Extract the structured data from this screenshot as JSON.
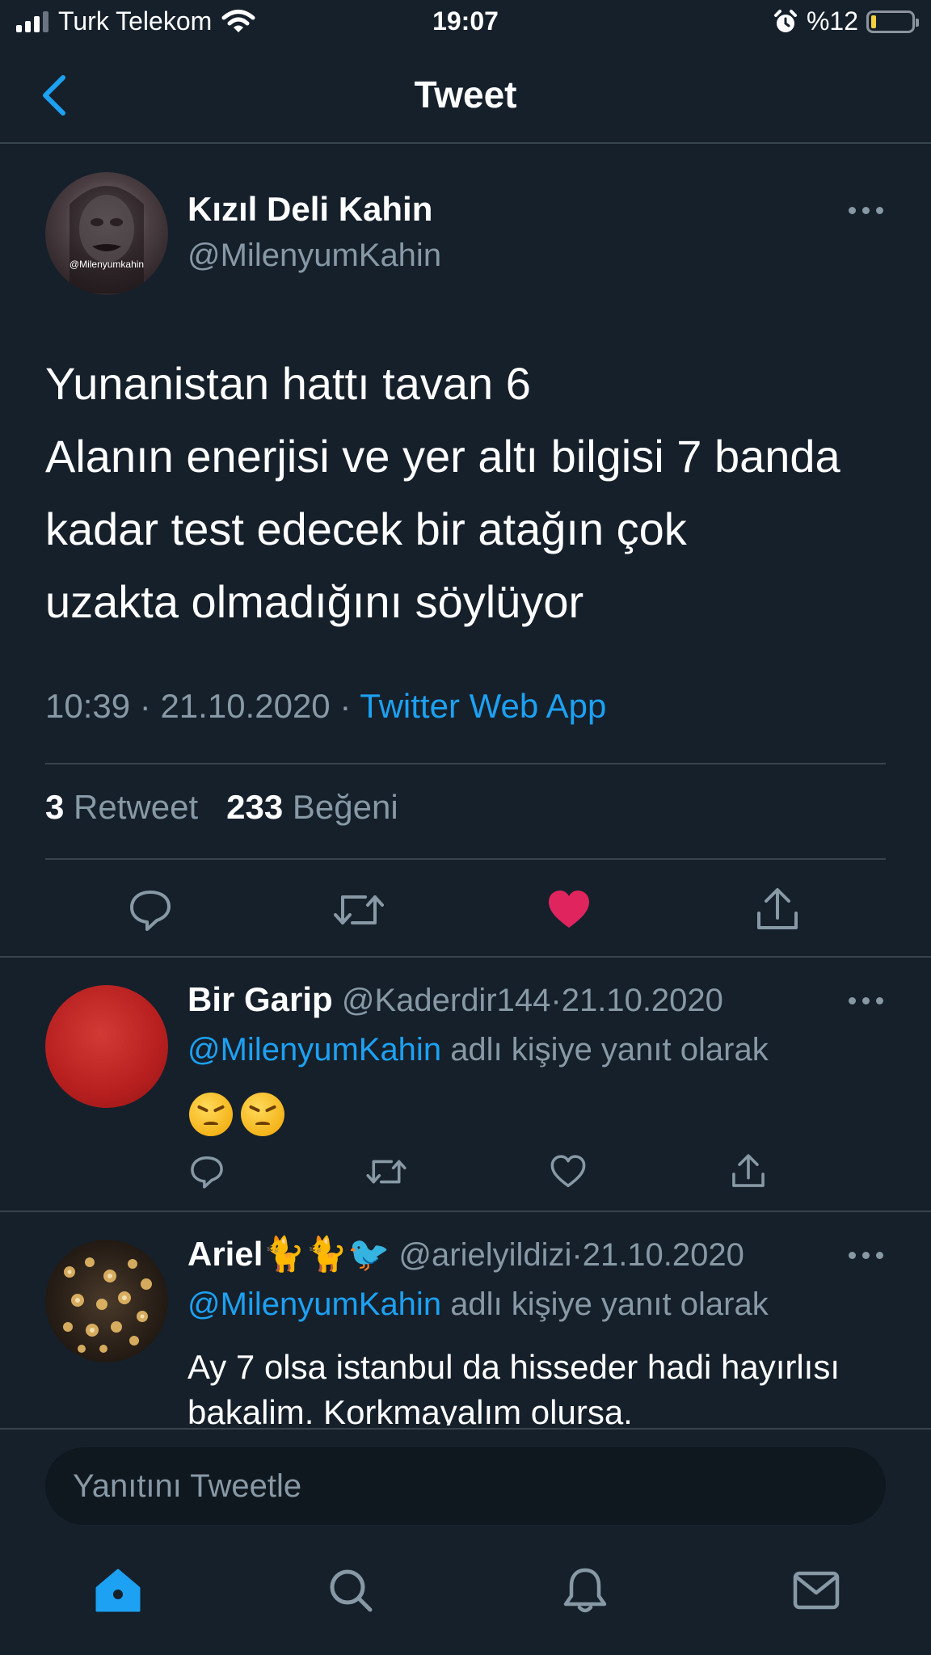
{
  "status_bar": {
    "carrier": "Turk Telekom",
    "time": "19:07",
    "battery_text": "%12",
    "battery_level": 0.12
  },
  "header": {
    "title": "Tweet"
  },
  "tweet": {
    "author_name": "Kızıl Deli Kahin",
    "author_handle": "@MilenyumKahin",
    "avatar_caption": "@Milenyumkahin",
    "text_lines": [
      "Yunanistan hattı tavan 6",
      "Alanın enerjisi ve yer altı bilgisi 7 banda",
      "kadar test edecek bir atağın çok",
      "uzakta olmadığını söylüyor"
    ],
    "time": "10:39",
    "date": "21.10.2020",
    "separator": "·",
    "source": "Twitter Web App",
    "retweet_count": "3",
    "retweet_label": "Retweet",
    "like_count": "233",
    "like_label": "Beğeni",
    "liked": true
  },
  "replies": [
    {
      "name": "Bir Garip",
      "handle": "@Kaderdir144",
      "date": "21.10.2020",
      "mention": "@MilenyumKahin",
      "reply_suffix": "adlı kişiye yanıt olarak",
      "emoji_count": 2,
      "avatar_color": "#c62828"
    },
    {
      "name": "Ariel",
      "name_emoji": "🐈🐈🐦",
      "handle": "@arielyildizi",
      "date": "21.10.2020",
      "mention": "@MilenyumKahin",
      "reply_suffix": "adlı kişiye yanıt olarak",
      "text_lines": [
        "Ay 7 olsa istanbul da hisseder hadi hayırlısı",
        "bakalim. Korkmayalım olursa."
      ]
    }
  ],
  "compose": {
    "placeholder": "Yanıtını Tweetle"
  },
  "tabbar": {
    "icons": [
      "home-icon",
      "search-icon",
      "notifications-icon",
      "messages-icon"
    ],
    "active": "home-icon"
  },
  "colors": {
    "background": "#15202b",
    "accent": "#1da1f2",
    "like": "#e0245e",
    "muted": "#8899a6",
    "divider": "#38444d"
  }
}
